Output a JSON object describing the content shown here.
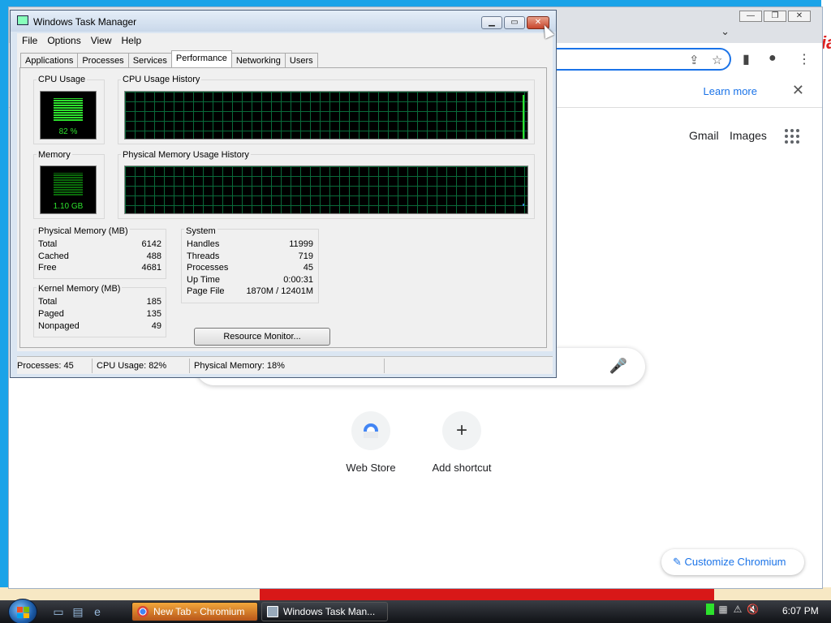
{
  "chromium": {
    "learn_more": "Learn more",
    "infobar_close": "✕",
    "gmail": "Gmail",
    "images": "Images",
    "shortcuts": [
      {
        "label": "Web Store"
      },
      {
        "label": "Add shortcut",
        "glyph": "+"
      }
    ],
    "customize": "Customize Chromium"
  },
  "task_manager": {
    "title": "Windows Task Manager",
    "menu": [
      "File",
      "Options",
      "View",
      "Help"
    ],
    "tabs": [
      "Applications",
      "Processes",
      "Services",
      "Performance",
      "Networking",
      "Users"
    ],
    "active_tab": "Performance",
    "cpu_usage_label": "CPU Usage",
    "cpu_usage_value": "82 %",
    "cpu_history_label": "CPU Usage History",
    "memory_label": "Memory",
    "memory_value": "1.10 GB",
    "memory_history_label": "Physical Memory Usage History",
    "physical_memory": {
      "label": "Physical Memory (MB)",
      "rows": [
        {
          "k": "Total",
          "v": "6142"
        },
        {
          "k": "Cached",
          "v": "488"
        },
        {
          "k": "Free",
          "v": "4681"
        }
      ]
    },
    "kernel_memory": {
      "label": "Kernel Memory (MB)",
      "rows": [
        {
          "k": "Total",
          "v": "185"
        },
        {
          "k": "Paged",
          "v": "135"
        },
        {
          "k": "Nonpaged",
          "v": "49"
        }
      ]
    },
    "system": {
      "label": "System",
      "rows": [
        {
          "k": "Handles",
          "v": "11999"
        },
        {
          "k": "Threads",
          "v": "719"
        },
        {
          "k": "Processes",
          "v": "45"
        },
        {
          "k": "Up Time",
          "v": "0:00:31"
        },
        {
          "k": "Page File",
          "v": "1870M / 12401M"
        }
      ]
    },
    "resource_monitor_button": "Resource Monitor...",
    "status": {
      "processes": "Processes: 45",
      "cpu": "CPU Usage: 82%",
      "memory": "Physical Memory: 18%"
    }
  },
  "taskbar": {
    "buttons": [
      {
        "label": "New Tab - Chromium"
      },
      {
        "label": "Windows Task Man..."
      }
    ],
    "clock": "6:07 PM"
  }
}
